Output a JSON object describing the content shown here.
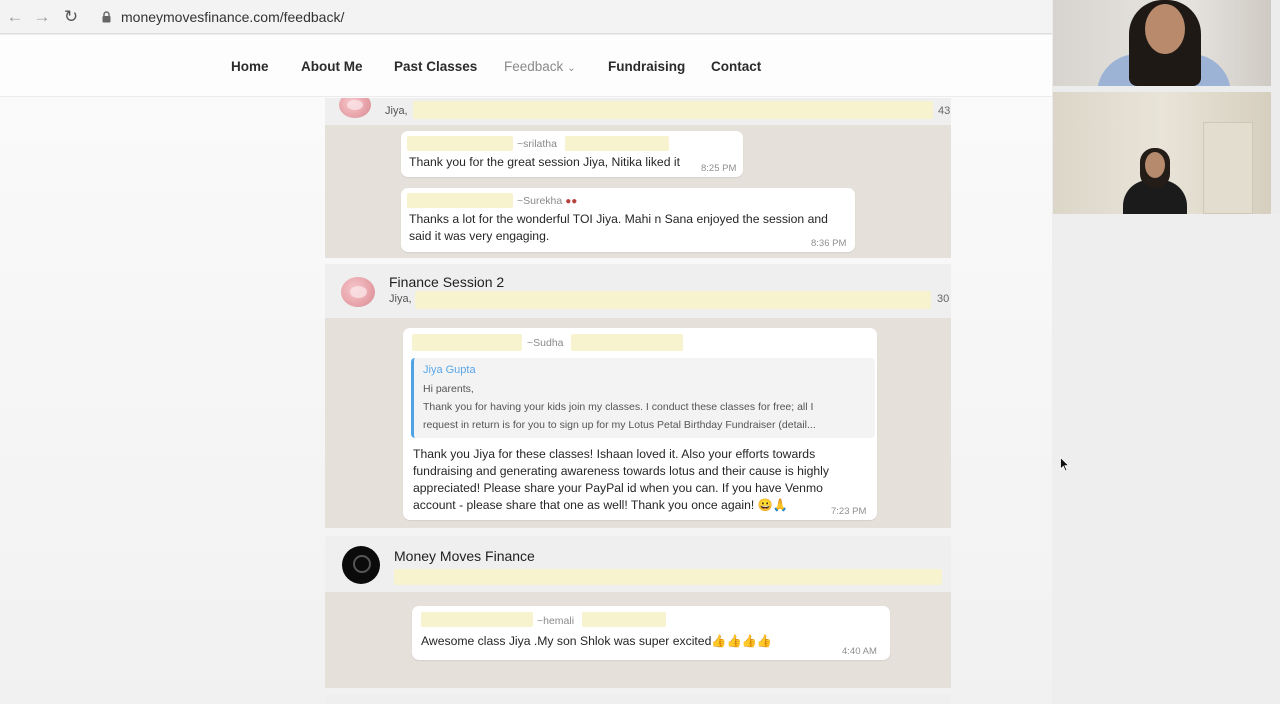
{
  "browser": {
    "url": "moneymovesfinance.com/feedback/",
    "icons": {
      "back": "back-arrow-icon",
      "forward": "forward-arrow-icon",
      "reload": "reload-icon",
      "lock": "lock-icon"
    }
  },
  "nav": {
    "items": [
      {
        "label": "Home"
      },
      {
        "label": "About Me"
      },
      {
        "label": "Past Classes"
      },
      {
        "label": "Feedback",
        "current": true
      },
      {
        "label": "Fundraising"
      },
      {
        "label": "Contact"
      }
    ]
  },
  "chats": [
    {
      "members": "Jiya,",
      "member_count": "43",
      "messages": [
        {
          "sender": "~srilatha",
          "text": "Thank you for the great session Jiya,  Nitika liked it",
          "time": "8:25 PM"
        },
        {
          "sender": "~Surekha",
          "text": "Thanks a lot for the wonderful TOI Jiya. Mahi n Sana enjoyed the session and said it was very engaging.",
          "time": "8:36 PM"
        }
      ]
    },
    {
      "title": "Finance Session 2",
      "members": "Jiya,",
      "member_count": "30",
      "messages": [
        {
          "sender": "~Sudha",
          "quote": {
            "author": "Jiya Gupta",
            "lines": [
              "Hi parents,",
              "Thank you for having your kids join my classes. I conduct these classes for free; all I",
              "request in return is for you to sign up for my Lotus Petal Birthday Fundraiser (detail..."
            ]
          },
          "text": "Thank you Jiya for these classes! Ishaan loved it. Also your efforts towards fundraising and generating awareness towards lotus and their cause is highly appreciated! Please share your PayPal id when you can. If you have Venmo account - please share that one as well! Thank you once again! 😀🙏",
          "time": "7:23 PM"
        }
      ]
    },
    {
      "title": "Money Moves Finance",
      "messages": [
        {
          "sender": "~hemali",
          "text": "Awesome class Jiya .My son Shlok was super excited👍👍👍👍",
          "time": "4:40 AM"
        }
      ]
    }
  ],
  "colors": {
    "chat_bg": "#e5e0da",
    "chat_header": "#efefef",
    "bubble": "#ffffff",
    "quote_bar": "#4fa3e3",
    "redaction": "#f7f3cf"
  }
}
